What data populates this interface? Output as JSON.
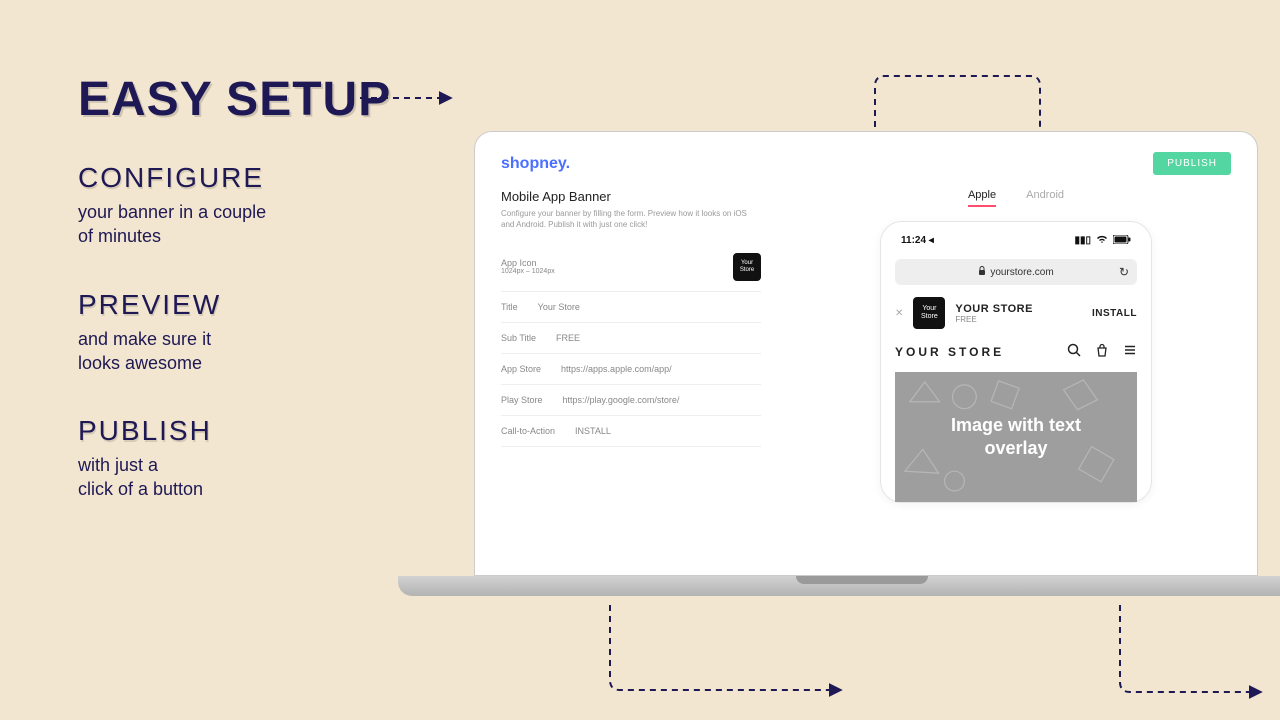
{
  "hero": {
    "title": "EASY SETUP",
    "steps": {
      "configure": {
        "head": "CONFIGURE",
        "sub1": "your banner in a couple",
        "sub2": "of minutes"
      },
      "preview": {
        "head": "PREVIEW",
        "sub1": "and make sure it",
        "sub2": "looks awesome"
      },
      "publish": {
        "head": "PUBLISH",
        "sub1": "with just a",
        "sub2": "click of a button"
      }
    }
  },
  "app": {
    "logo": "shopney.",
    "publish_btn": "PUBLISH",
    "form": {
      "title": "Mobile App Banner",
      "description": "Configure your banner by filling the form. Preview how it looks on iOS and Android. Publish it with just one click!",
      "fields": {
        "app_icon": {
          "label": "App Icon",
          "hint": "1024px – 1024px",
          "thumb": "Your Store"
        },
        "title": {
          "label": "Title",
          "value": "Your Store"
        },
        "sub_title": {
          "label": "Sub Title",
          "value": "FREE"
        },
        "app_store": {
          "label": "App Store",
          "value": "https://apps.apple.com/app/"
        },
        "play_store": {
          "label": "Play Store",
          "value": "https://play.google.com/store/"
        },
        "cta": {
          "label": "Call-to-Action",
          "value": "INSTALL"
        }
      }
    },
    "preview": {
      "tabs": {
        "apple": "Apple",
        "android": "Android"
      },
      "status": {
        "time": "11:24 ◂"
      },
      "url": "yourstore.com",
      "banner": {
        "title": "YOUR STORE",
        "sub": "FREE",
        "install": "INSTALL",
        "icon": "Your Store"
      },
      "store_brand": "YOUR STORE",
      "hero_text": "Image with text overlay"
    }
  }
}
